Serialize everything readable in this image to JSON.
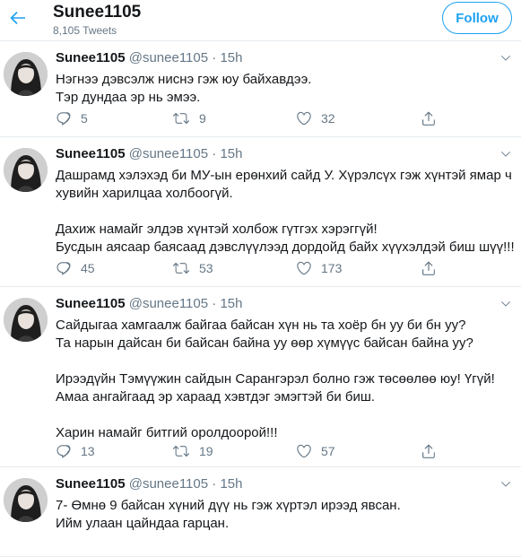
{
  "header": {
    "title": "Sunee1105",
    "tweet_count": "8,105 Tweets",
    "follow_label": "Follow"
  },
  "colors": {
    "accent": "#1da1f2",
    "muted": "#657786",
    "text": "#14171a",
    "border": "#e6ecf0"
  },
  "icons": {
    "back": "arrow-left-icon",
    "menu": "chevron-down-icon",
    "reply": "reply-icon",
    "retweet": "retweet-icon",
    "like": "heart-icon",
    "share": "share-icon"
  },
  "tweets": [
    {
      "name": "Sunee1105",
      "handle": "@sunee1105",
      "sep": "·",
      "time": "15h",
      "lines": [
        "Нэгнээ дэвсэлж ниснэ гэж юу байхавдээ.",
        "Тэр дундаа эр нь эмээ."
      ],
      "replies": "5",
      "retweets": "9",
      "likes": "32"
    },
    {
      "name": "Sunee1105",
      "handle": "@sunee1105",
      "sep": "·",
      "time": "15h",
      "lines": [
        "Дашрамд хэлэхэд би МУ-ын ерөнхий сайд У. Хүрэлсүх гэж хүнтэй ямар ч",
        "хувийн харилцаа холбоогүй.",
        "",
        "Дахиж намайг элдэв хүнтэй холбож гүтгэх хэрэггүй!",
        "Бусдын аясаар баясаад дэвслүүлээд дордойд байх хүүхэлдэй биш шүү!!!"
      ],
      "replies": "45",
      "retweets": "53",
      "likes": "173"
    },
    {
      "name": "Sunee1105",
      "handle": "@sunee1105",
      "sep": "·",
      "time": "15h",
      "lines": [
        "Сайдыгаа хамгаалж байгаа байсан хүн нь та хоёр бн уу би бн уу?",
        "Та нарын дайсан би байсан байна уу өөр хүмүүс байсан байна уу?",
        "",
        "Ирээдүйн Тэмүүжин сайдын Сарангэрэл болно гэж төсөөлөө юу! Үгүй!",
        "Амаа ангайгаад эр хараад хэвтдэг эмэгтэй би биш.",
        "",
        "Харин намайг битгий оролдоорой!!!"
      ],
      "replies": "13",
      "retweets": "19",
      "likes": "57"
    },
    {
      "name": "Sunee1105",
      "handle": "@sunee1105",
      "sep": "·",
      "time": "15h",
      "lines": [
        "7- Өмнө 9 байсан хүний дүү нь гэж хүртэл ирээд явсан.",
        "Ийм улаан цайндаа гарцан."
      ]
    }
  ]
}
